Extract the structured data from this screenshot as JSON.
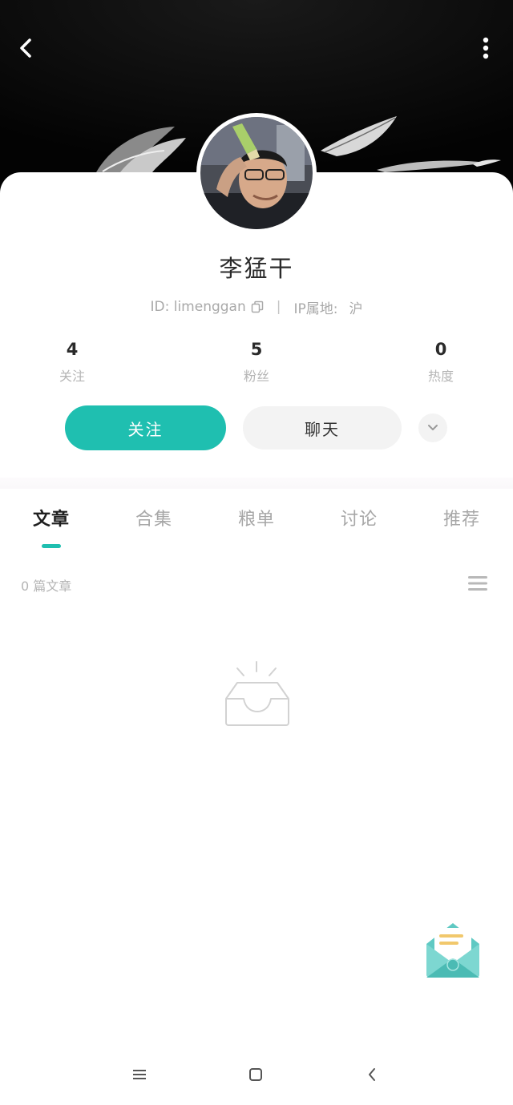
{
  "profile": {
    "name": "李猛干",
    "id_text": "ID: limenggan",
    "ip_label": "IP属地:",
    "ip_value": "沪"
  },
  "stats": [
    {
      "value": "4",
      "label": "关注"
    },
    {
      "value": "5",
      "label": "粉丝"
    },
    {
      "value": "0",
      "label": "热度"
    }
  ],
  "actions": {
    "follow_label": "关注",
    "chat_label": "聊天"
  },
  "tabs": [
    {
      "label": "文章",
      "active": true
    },
    {
      "label": "合集",
      "active": false
    },
    {
      "label": "粮单",
      "active": false
    },
    {
      "label": "讨论",
      "active": false
    },
    {
      "label": "推荐",
      "active": false
    }
  ],
  "content": {
    "count_label": "0 篇文章"
  },
  "icons": {
    "back": "back-chevron-icon",
    "more": "more-vertical-icon",
    "copy": "copy-icon",
    "expand": "chevron-down-icon",
    "list": "list-view-icon",
    "empty": "empty-inbox-icon",
    "mail": "mail-envelope-icon",
    "nav_menu": "menu-icon",
    "nav_home": "home-square-icon",
    "nav_back": "back-icon"
  },
  "colors": {
    "accent": "#1fbfb0",
    "header_bg": "#050505",
    "text_primary": "#2a2a2a",
    "text_secondary": "#a9a9a9"
  }
}
